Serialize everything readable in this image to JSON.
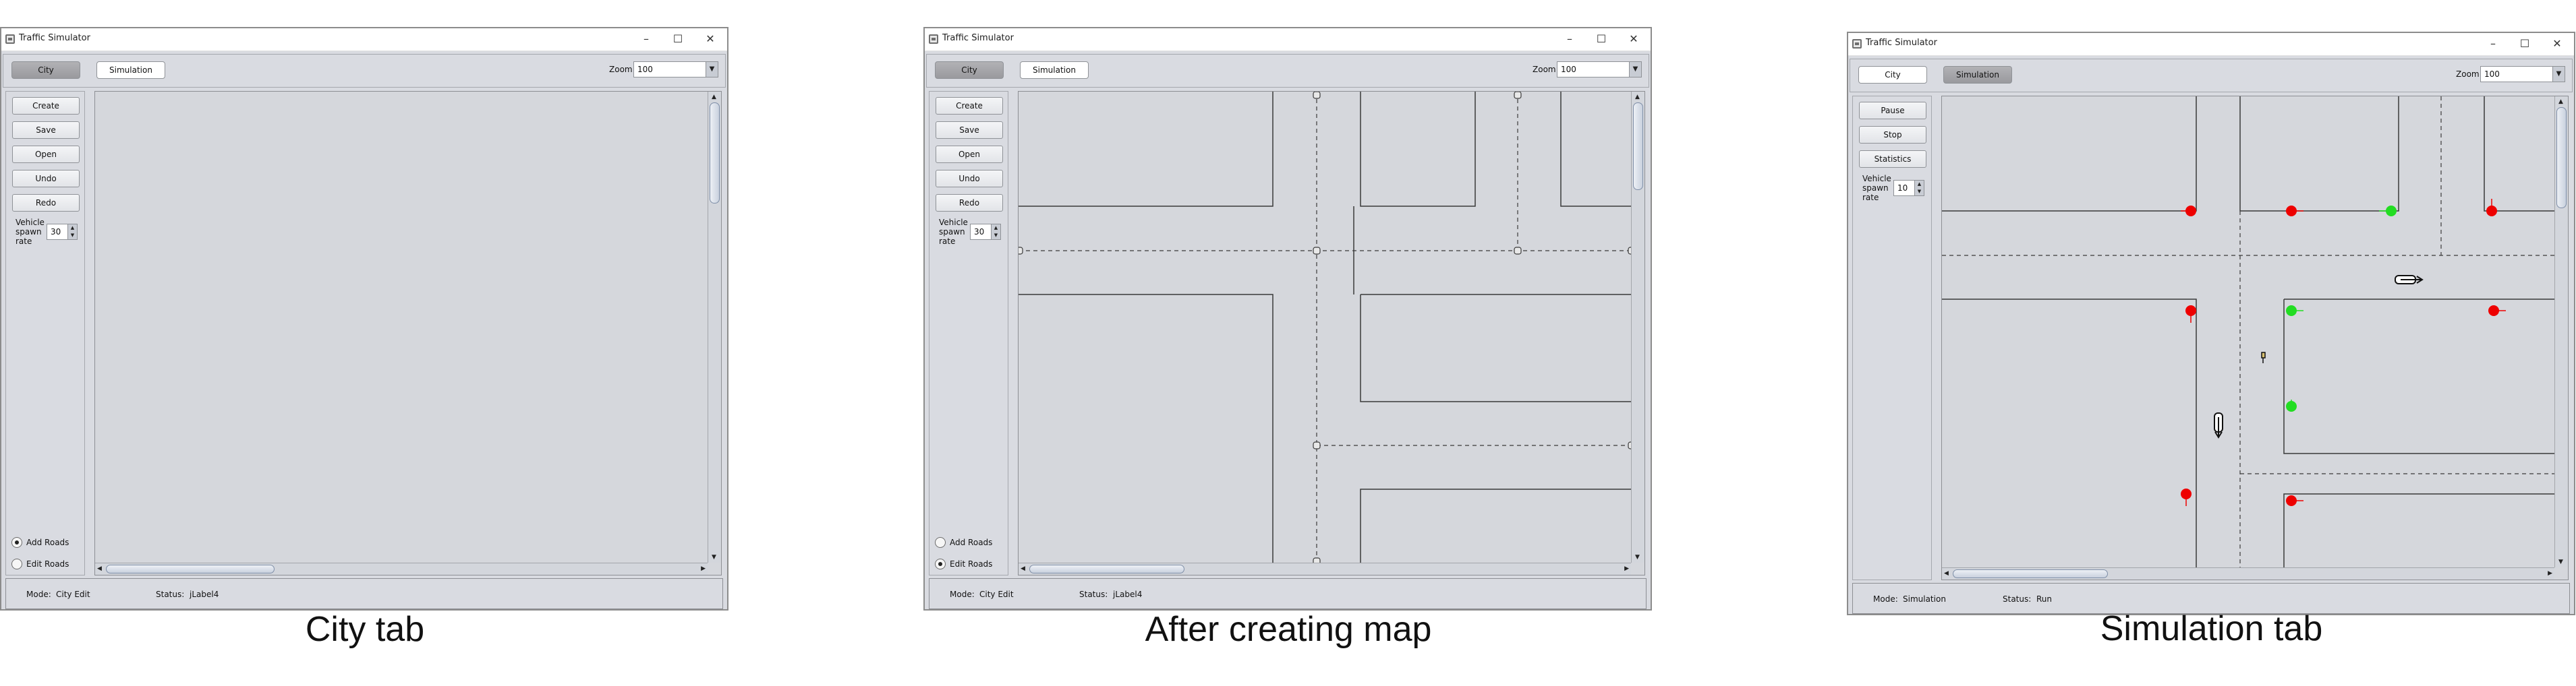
{
  "panels": [
    {
      "caption": "City tab",
      "window": {
        "title": "Traffic Simulator",
        "controls": {
          "minimize": "–",
          "maximize": "☐",
          "close": "✕"
        },
        "tabs": [
          {
            "label": "City",
            "active": true
          },
          {
            "label": "Simulation",
            "active": false
          }
        ],
        "zoom": {
          "label": "Zoom:",
          "value": "100"
        },
        "sidebar_buttons": [
          "Create",
          "Save",
          "Open",
          "Undo",
          "Redo"
        ],
        "spawn_rate": {
          "label": "Vehicle spawn rate",
          "value": "30"
        },
        "modes": [
          {
            "label": "Add Roads",
            "selected": true
          },
          {
            "label": "Edit Roads",
            "selected": false
          }
        ],
        "status": {
          "mode_label": "Mode:",
          "mode_value": "City Edit",
          "status_label": "Status:",
          "status_value": "jLabel4"
        }
      }
    },
    {
      "caption": "After creating map",
      "window": {
        "title": "Traffic Simulator",
        "controls": {
          "minimize": "–",
          "maximize": "☐",
          "close": "✕"
        },
        "tabs": [
          {
            "label": "City",
            "active": true
          },
          {
            "label": "Simulation",
            "active": false
          }
        ],
        "zoom": {
          "label": "Zoom:",
          "value": "100"
        },
        "sidebar_buttons": [
          "Create",
          "Save",
          "Open",
          "Undo",
          "Redo"
        ],
        "spawn_rate": {
          "label": "Vehicle spawn rate",
          "value": "30"
        },
        "modes": [
          {
            "label": "Add Roads",
            "selected": false
          },
          {
            "label": "Edit Roads",
            "selected": true
          }
        ],
        "status": {
          "mode_label": "Mode:",
          "mode_value": "City Edit",
          "status_label": "Status:",
          "status_value": "jLabel4"
        }
      }
    },
    {
      "caption": "Simulation tab",
      "window": {
        "title": "Traffic Simulator",
        "controls": {
          "minimize": "–",
          "maximize": "☐",
          "close": "✕"
        },
        "tabs": [
          {
            "label": "City",
            "active": false
          },
          {
            "label": "Simulation",
            "active": true
          }
        ],
        "zoom": {
          "label": "Zoom:",
          "value": "100"
        },
        "sidebar_buttons": [
          "Pause",
          "Stop",
          "Statistics"
        ],
        "spawn_rate": {
          "label": "Vehicle spawn rate",
          "value": "10"
        },
        "status": {
          "mode_label": "Mode:",
          "mode_value": "Simulation",
          "status_label": "Status:",
          "status_value": "Run"
        }
      }
    }
  ],
  "colors": {
    "signal_red": "#ee0000",
    "signal_green": "#22dd22",
    "window_bg": "#d9dbe1",
    "canvas_bg": "#d5d7dc"
  }
}
